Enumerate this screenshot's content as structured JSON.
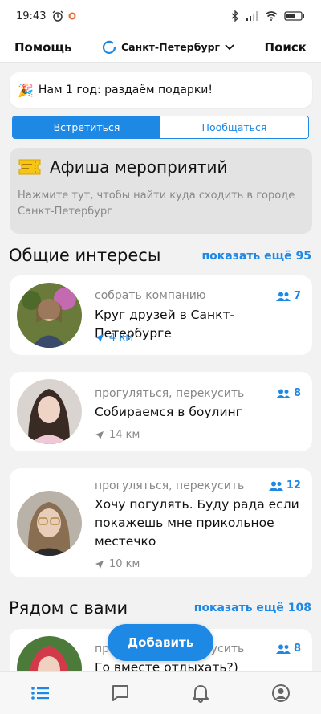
{
  "status": {
    "time": "19:43",
    "battery": "53"
  },
  "header": {
    "help": "Помощь",
    "city": "Санкт-Петербург",
    "search": "Поиск"
  },
  "banner": {
    "emoji": "🎉",
    "text": "Нам 1 год: раздаём подарки!"
  },
  "tabs": [
    {
      "label": "Встретиться",
      "active": true
    },
    {
      "label": "Пообщаться",
      "active": false
    }
  ],
  "afisha": {
    "icon": "ticket-icon",
    "title": "Афиша мероприятий",
    "description": "Нажмите тут, чтобы найти куда сходить в городе Санкт-Петербург"
  },
  "interests": {
    "title": "Общие интересы",
    "more": "показать ещё 95",
    "cards": [
      {
        "category": "собрать компанию",
        "count": "7",
        "title": "Круг друзей в Санкт-Петербурге",
        "distance": "4 км",
        "distance_color": "#1e88e5"
      },
      {
        "category": "прогуляться, перекусить",
        "count": "8",
        "title": "Собираемся в боулинг",
        "distance": "14 км",
        "distance_color": "#888888"
      },
      {
        "category": "прогуляться, перекусить",
        "count": "12",
        "title": "Хочу погулять. Буду рада если покажешь мне  прикольное местечко",
        "distance": "10 км",
        "distance_color": "#888888"
      }
    ]
  },
  "nearby": {
    "title": "Рядом с вами",
    "more": "показать ещё 108",
    "cards": [
      {
        "category": "прогуляться, перекусить",
        "count": "8",
        "title": "Го вместе отдыхать?)"
      }
    ]
  },
  "add_button": "Добавить",
  "nav": [
    "list-icon",
    "chat-icon",
    "bell-icon",
    "profile-icon"
  ],
  "colors": {
    "accent": "#1e88e5",
    "background": "#f2f2f2"
  }
}
